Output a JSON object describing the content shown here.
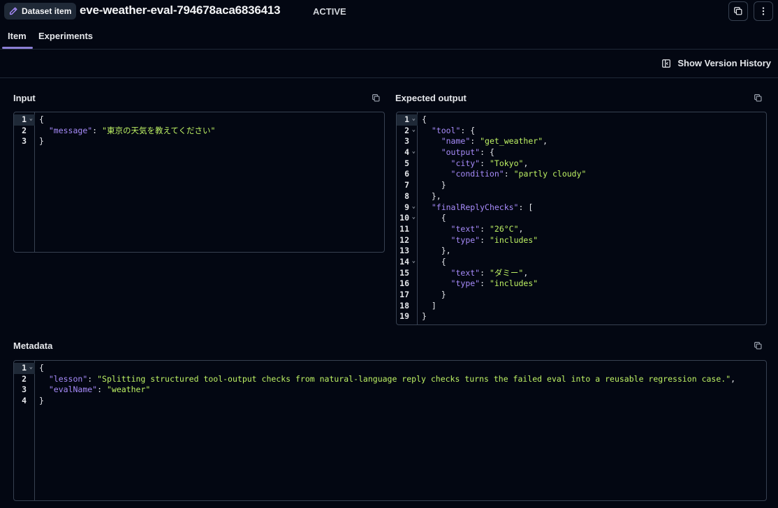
{
  "header": {
    "badge_label": "Dataset item",
    "title": "eve-weather-eval-794678aca6836413",
    "status": "ACTIVE"
  },
  "tabs": [
    {
      "label": "Item"
    },
    {
      "label": "Experiments"
    }
  ],
  "toolbar": {
    "history_label": "Show Version History"
  },
  "sections": {
    "input": {
      "label": "Input",
      "lines": [
        {
          "n": "1",
          "fold": true,
          "code": "{"
        },
        {
          "n": "2",
          "fold": false,
          "code": "  \"message\": \"東京の天気を教えてください\""
        },
        {
          "n": "3",
          "fold": false,
          "code": "}"
        }
      ]
    },
    "expected": {
      "label": "Expected output",
      "lines": [
        {
          "n": "1",
          "fold": true,
          "code": "{"
        },
        {
          "n": "2",
          "fold": true,
          "code": "  \"tool\": {"
        },
        {
          "n": "3",
          "fold": false,
          "code": "    \"name\": \"get_weather\","
        },
        {
          "n": "4",
          "fold": true,
          "code": "    \"output\": {"
        },
        {
          "n": "5",
          "fold": false,
          "code": "      \"city\": \"Tokyo\","
        },
        {
          "n": "6",
          "fold": false,
          "code": "      \"condition\": \"partly cloudy\""
        },
        {
          "n": "7",
          "fold": false,
          "code": "    }"
        },
        {
          "n": "8",
          "fold": false,
          "code": "  },"
        },
        {
          "n": "9",
          "fold": true,
          "code": "  \"finalReplyChecks\": ["
        },
        {
          "n": "10",
          "fold": true,
          "code": "    {"
        },
        {
          "n": "11",
          "fold": false,
          "code": "      \"text\": \"26°C\","
        },
        {
          "n": "12",
          "fold": false,
          "code": "      \"type\": \"includes\""
        },
        {
          "n": "13",
          "fold": false,
          "code": "    },"
        },
        {
          "n": "14",
          "fold": true,
          "code": "    {"
        },
        {
          "n": "15",
          "fold": false,
          "code": "      \"text\": \"ダミー\","
        },
        {
          "n": "16",
          "fold": false,
          "code": "      \"type\": \"includes\""
        },
        {
          "n": "17",
          "fold": false,
          "code": "    }"
        },
        {
          "n": "18",
          "fold": false,
          "code": "  ]"
        },
        {
          "n": "19",
          "fold": false,
          "code": "}"
        }
      ]
    },
    "metadata": {
      "label": "Metadata",
      "lines": [
        {
          "n": "1",
          "fold": true,
          "code": "{"
        },
        {
          "n": "2",
          "fold": false,
          "code": "  \"lesson\": \"Splitting structured tool-output checks from natural-language reply checks turns the failed eval into a reusable regression case.\","
        },
        {
          "n": "3",
          "fold": false,
          "code": "  \"evalName\": \"weather\""
        },
        {
          "n": "4",
          "fold": false,
          "code": "}"
        }
      ]
    }
  },
  "icons": {
    "badge": "pencil-icon",
    "copy": "copy-icon",
    "more": "more-vertical-icon",
    "history": "panel-icon",
    "fold": "chevron-down-icon"
  },
  "colors": {
    "background": "#030712",
    "key": "#a78bfa",
    "string": "#bef264",
    "accent": "#8b7fd6",
    "border": "#374151"
  }
}
